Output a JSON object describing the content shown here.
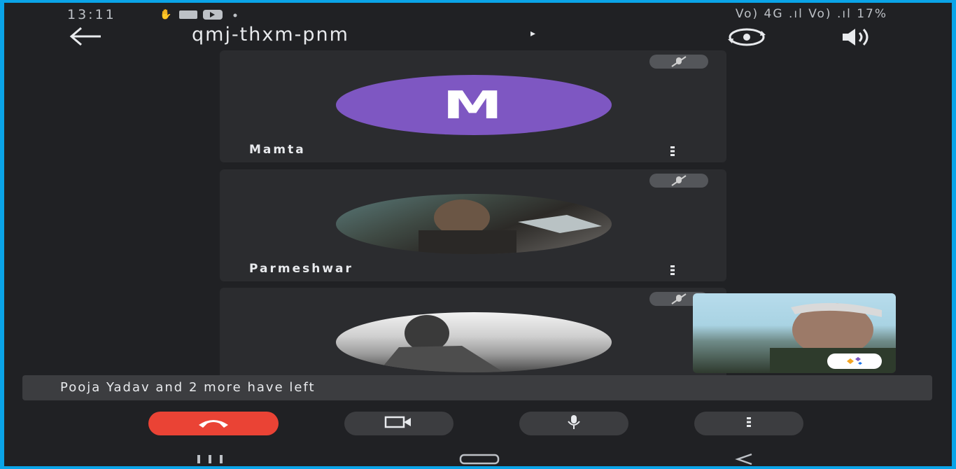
{
  "status_bar": {
    "time": "13:11",
    "notification_icons": "wave-icon message-icon youtube-icon dot-icon",
    "right_text": "Vo) 4G .ıl Vo) .ıl 17%"
  },
  "header": {
    "meeting_code": "qmj-thxm-pnm",
    "caret": "▸",
    "back_icon": "arrow-left-icon",
    "switch_camera_icon": "switch-camera-icon",
    "speaker_icon": "speaker-icon"
  },
  "participants": [
    {
      "name": "Mamta",
      "avatar_letter": "M",
      "avatar_color": "#7e57c2",
      "muted": true
    },
    {
      "name": "Parmeshwar",
      "avatar_type": "photo",
      "muted": true
    },
    {
      "name": "",
      "avatar_type": "photo",
      "muted": true
    }
  ],
  "toast": {
    "text": "Pooja Yadav and 2 more have left"
  },
  "controls": {
    "end_call_icon": "phone-hangup-icon",
    "camera_icon": "video-camera-icon",
    "mic_icon": "microphone-icon",
    "more_icon": "more-vert-icon"
  },
  "colors": {
    "background": "#202124",
    "tile": "#2b2c2f",
    "end_call": "#ea4335",
    "frame": "#0aa4e8"
  }
}
